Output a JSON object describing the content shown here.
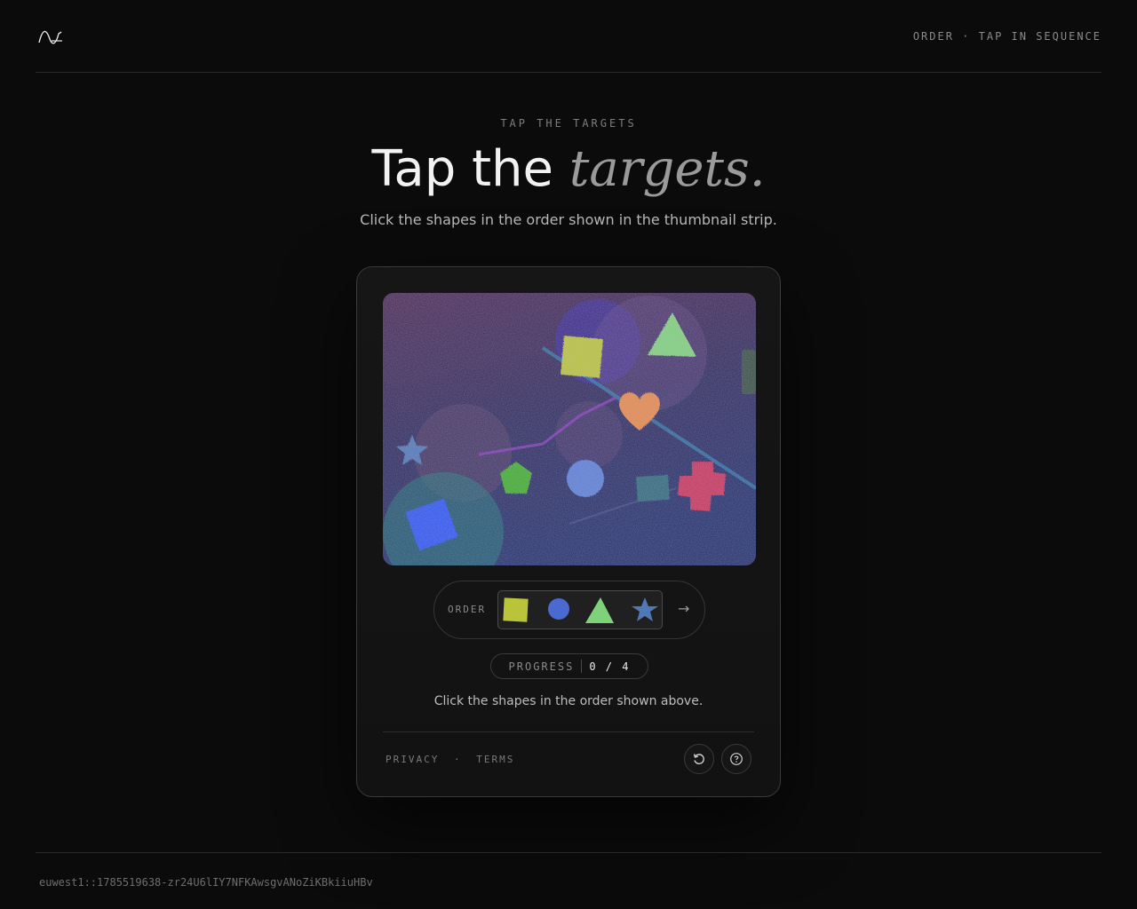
{
  "header": {
    "logo_icon": "wave-logo-icon",
    "meta": "ORDER · TAP IN SEQUENCE"
  },
  "hero": {
    "eyebrow": "TAP THE TARGETS",
    "title_main": "Tap the",
    "title_accent": "targets.",
    "subtitle": "Click the shapes in the order shown in the thumbnail strip."
  },
  "challenge": {
    "order_label": "ORDER",
    "order_sequence": [
      "square",
      "circle",
      "triangle",
      "star"
    ],
    "next_icon": "arrow-right-icon",
    "progress_label": "PROGRESS",
    "progress_value": "0 / 4",
    "progress_done": 0,
    "progress_total": 4,
    "instruction": "Click the shapes in the order shown above.",
    "links": {
      "privacy": "PRIVACY",
      "separator": "·",
      "terms": "TERMS"
    },
    "buttons": {
      "reload_icon": "reload-icon",
      "help_icon": "help-icon"
    },
    "shapes": [
      {
        "kind": "square",
        "color": "#b9c43a"
      },
      {
        "kind": "triangle",
        "color": "#7fd27a"
      },
      {
        "kind": "heart",
        "color": "#e58a4a"
      },
      {
        "kind": "star",
        "color": "#4f78b5"
      },
      {
        "kind": "pentagon",
        "color": "#3fae2a"
      },
      {
        "kind": "circle",
        "color": "#5a7fd4"
      },
      {
        "kind": "rectangle",
        "color": "#2f6a78"
      },
      {
        "kind": "cross",
        "color": "#c8355a"
      },
      {
        "kind": "square",
        "color": "#2f56f0"
      }
    ]
  },
  "footer": {
    "request_id": "euwest1::1785519638-zr24U6lIY7NFKAwsgvANoZiKBkiiuHBv"
  }
}
